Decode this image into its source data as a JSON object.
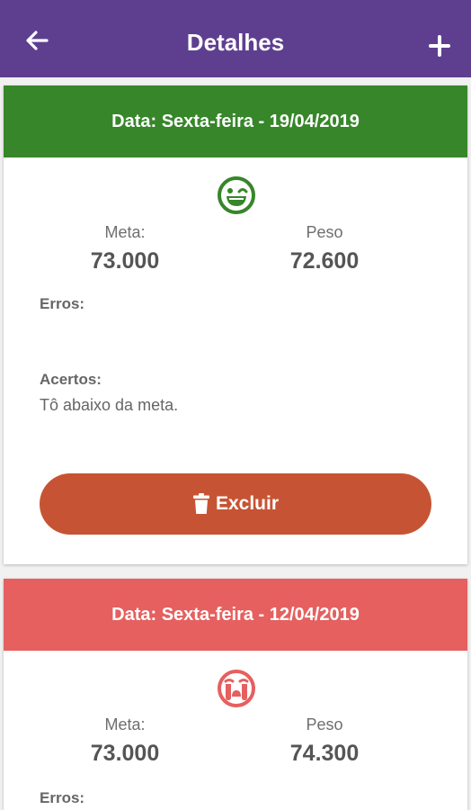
{
  "appbar": {
    "title": "Detalhes",
    "back_icon": "arrow-left-icon",
    "add_icon": "plus-icon",
    "color": "#5e3f8f"
  },
  "entries": [
    {
      "date_label": "Data: Sexta-feira - 19/04/2019",
      "header_color": "#37862a",
      "mood_icon": "winking-face-icon",
      "mood_color": "#37862a",
      "meta_label": "Meta:",
      "meta_value": "73.000",
      "peso_label": "Peso",
      "peso_value": "72.600",
      "erros_label": "Erros:",
      "erros_text": "",
      "acertos_label": "Acertos:",
      "acertos_text": "Tô abaixo da meta.",
      "delete_label": "Excluir",
      "delete_icon": "trash-icon",
      "delete_color": "#c65434"
    },
    {
      "date_label": "Data: Sexta-feira - 12/04/2019",
      "header_color": "#e5605f",
      "mood_icon": "crying-face-icon",
      "mood_color": "#e5605f",
      "meta_label": "Meta:",
      "meta_value": "73.000",
      "peso_label": "Peso",
      "peso_value": "74.300",
      "erros_label": "Erros:"
    }
  ]
}
